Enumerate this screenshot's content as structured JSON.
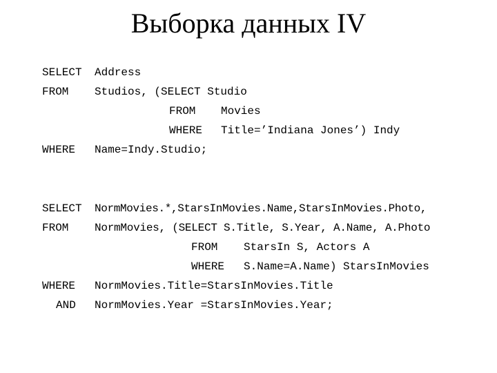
{
  "slide": {
    "title": "Выборка данных IV"
  },
  "query1": {
    "lines": [
      {
        "kw": "SELECT",
        "text": "Address"
      },
      {
        "kw": "FROM",
        "text": "Studios, (SELECT Studio"
      },
      {
        "kw": "FROM",
        "text": "Movies"
      },
      {
        "kw": "WHERE",
        "text": "Title=’Indiana Jones’) Indy"
      },
      {
        "kw": "WHERE",
        "text": "Name=Indy.Studio;"
      }
    ]
  },
  "query2": {
    "lines": [
      {
        "kw": "SELECT",
        "text": "NormMovies.*,StarsInMovies.Name,StarsInMovies.Photo,"
      },
      {
        "kw": "FROM",
        "text": "NormMovies, (SELECT S.Title, S.Year, A.Name, A.Photo"
      },
      {
        "kw": "FROM",
        "text": "StarsIn S, Actors A"
      },
      {
        "kw": "WHERE",
        "text": "S.Name=A.Name) StarsInMovies"
      },
      {
        "kw": "WHERE",
        "text": "NormMovies.Title=StarsInMovies.Title"
      },
      {
        "kw": "AND",
        "text": "NormMovies.Year =StarsInMovies.Year;"
      }
    ]
  }
}
